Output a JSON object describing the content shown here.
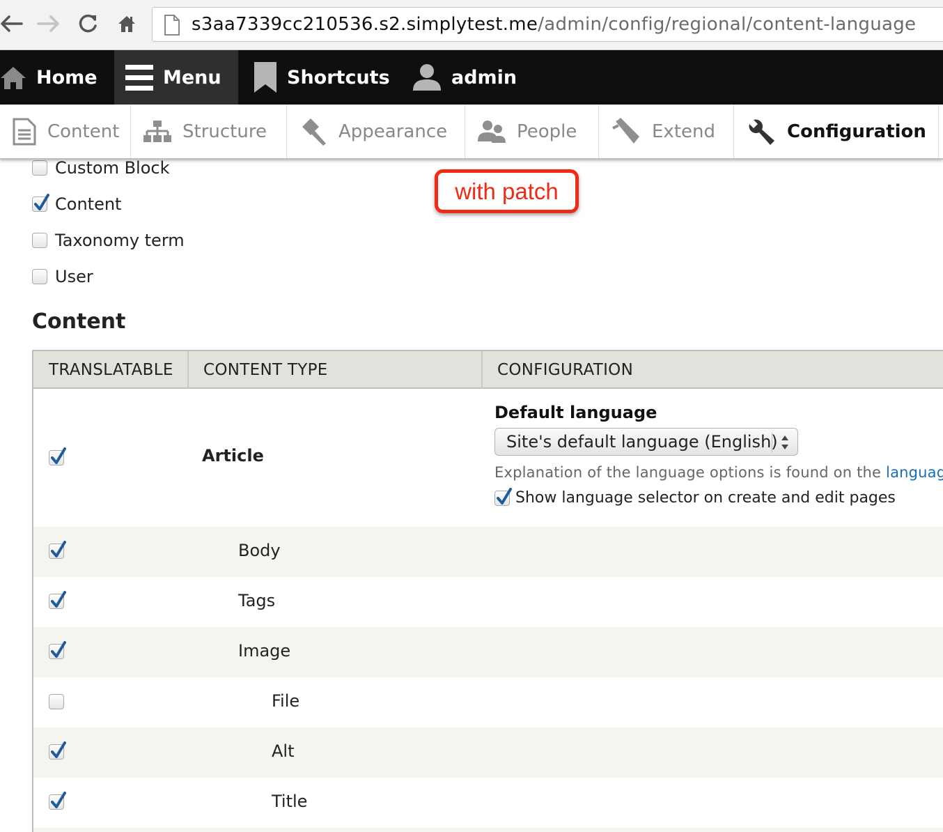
{
  "browser": {
    "url_host": "s3aa7339cc210536.s2.simplytest.me",
    "url_path": "/admin/config/regional/content-language"
  },
  "toolbar": {
    "home": "Home",
    "menu": "Menu",
    "shortcuts": "Shortcuts",
    "user": "admin"
  },
  "tray": {
    "items": [
      {
        "label": "Content",
        "icon": "document-icon"
      },
      {
        "label": "Structure",
        "icon": "sitemap-icon"
      },
      {
        "label": "Appearance",
        "icon": "paintbrush-icon"
      },
      {
        "label": "People",
        "icon": "people-icon"
      },
      {
        "label": "Extend",
        "icon": "puzzle-icon"
      },
      {
        "label": "Configuration",
        "icon": "wrench-icon"
      }
    ]
  },
  "entities": [
    {
      "label": "Custom Block",
      "checked": false
    },
    {
      "label": "Content",
      "checked": true
    },
    {
      "label": "Taxonomy term",
      "checked": false
    },
    {
      "label": "User",
      "checked": false
    }
  ],
  "annotation": "with patch",
  "section_title": "Content",
  "table": {
    "headers": [
      "TRANSLATABLE",
      "CONTENT TYPE",
      "CONFIGURATION"
    ],
    "rows": [
      {
        "label": "Article",
        "checked": true
      },
      {
        "label": "Body",
        "checked": true
      },
      {
        "label": "Tags",
        "checked": true
      },
      {
        "label": "Image",
        "checked": true
      },
      {
        "label": "File",
        "checked": false
      },
      {
        "label": "Alt",
        "checked": true
      },
      {
        "label": "Title",
        "checked": true
      }
    ],
    "config": {
      "title": "Default language",
      "select_value": "Site's default language (English)",
      "help_text": "Explanation of the language options is found on the ",
      "help_link": "languag",
      "show_selector_label": "Show language selector on create and edit pages",
      "show_selector_checked": true
    }
  }
}
